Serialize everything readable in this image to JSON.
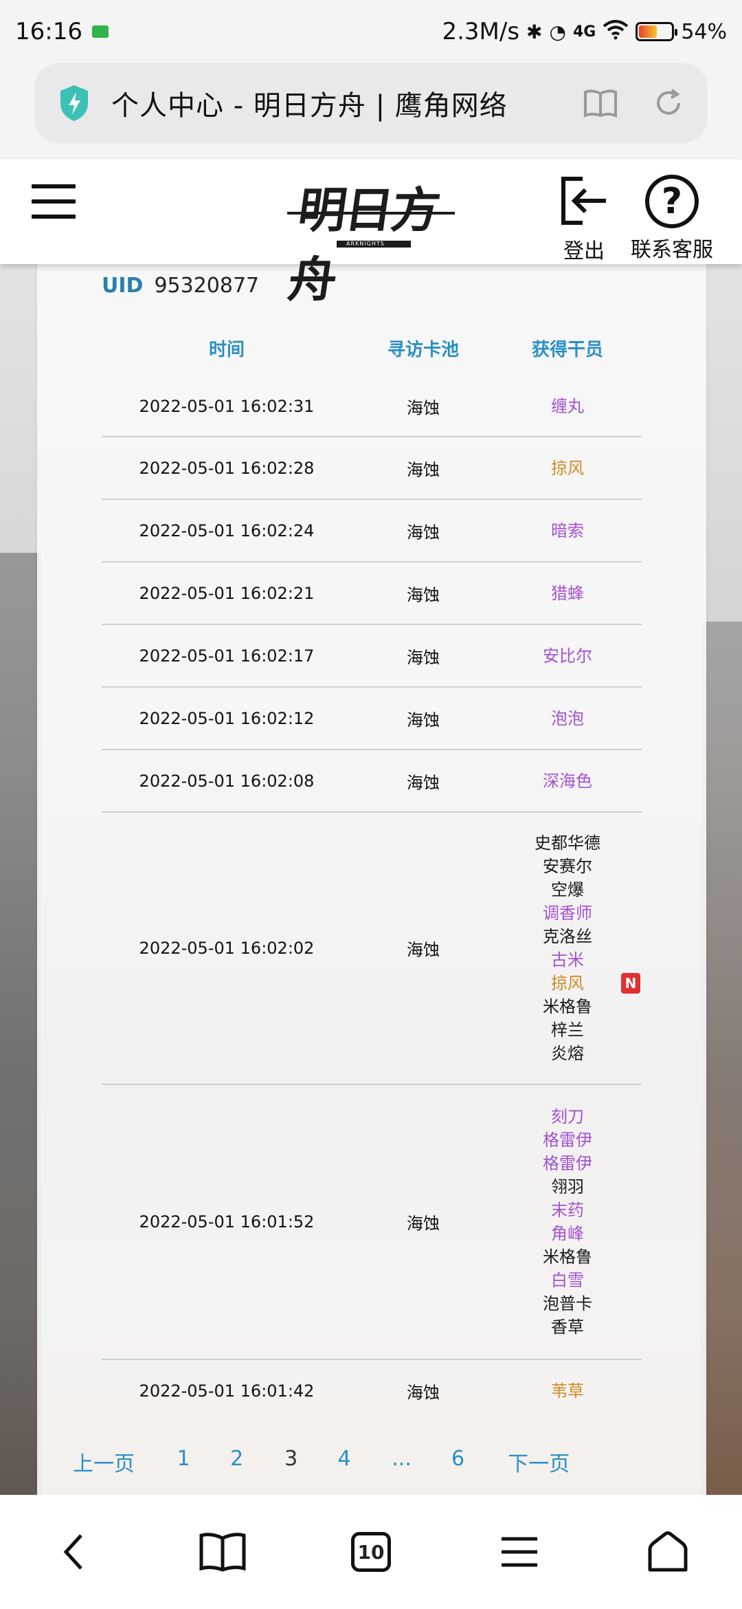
{
  "status_bar": {
    "time": "16:16",
    "speed": "2.3M/s",
    "network": "4G",
    "battery": "54%"
  },
  "address_bar": {
    "title": "个人中心 - 明日方舟 | 鹰角网络"
  },
  "header": {
    "logo_text": "明日方舟",
    "logo_sub": "ARKNIGHTS",
    "logout_label": "登出",
    "support_label": "联系客服"
  },
  "card": {
    "uid_label": "UID",
    "uid_value": "95320877",
    "columns": [
      "时间",
      "寻访卡池",
      "获得干员"
    ],
    "rows": [
      {
        "time": "2022-05-01 16:02:31",
        "pool": "海蚀",
        "ops": [
          {
            "name": "缠丸",
            "rarity": "purple"
          }
        ]
      },
      {
        "time": "2022-05-01 16:02:28",
        "pool": "海蚀",
        "ops": [
          {
            "name": "掠风",
            "rarity": "gold"
          }
        ]
      },
      {
        "time": "2022-05-01 16:02:24",
        "pool": "海蚀",
        "ops": [
          {
            "name": "暗索",
            "rarity": "purple"
          }
        ]
      },
      {
        "time": "2022-05-01 16:02:21",
        "pool": "海蚀",
        "ops": [
          {
            "name": "猎蜂",
            "rarity": "purple"
          }
        ]
      },
      {
        "time": "2022-05-01 16:02:17",
        "pool": "海蚀",
        "ops": [
          {
            "name": "安比尔",
            "rarity": "purple"
          }
        ]
      },
      {
        "time": "2022-05-01 16:02:12",
        "pool": "海蚀",
        "ops": [
          {
            "name": "泡泡",
            "rarity": "purple"
          }
        ]
      },
      {
        "time": "2022-05-01 16:02:08",
        "pool": "海蚀",
        "ops": [
          {
            "name": "深海色",
            "rarity": "purple"
          }
        ]
      },
      {
        "time": "2022-05-01 16:02:02",
        "pool": "海蚀",
        "ops": [
          {
            "name": "史都华德",
            "rarity": "plain"
          },
          {
            "name": "安赛尔",
            "rarity": "plain"
          },
          {
            "name": "空爆",
            "rarity": "plain"
          },
          {
            "name": "调香师",
            "rarity": "purple"
          },
          {
            "name": "克洛丝",
            "rarity": "plain"
          },
          {
            "name": "古米",
            "rarity": "purple"
          },
          {
            "name": "掠风",
            "rarity": "gold",
            "badge": "N"
          },
          {
            "name": "米格鲁",
            "rarity": "plain"
          },
          {
            "name": "梓兰",
            "rarity": "plain"
          },
          {
            "name": "炎熔",
            "rarity": "plain"
          }
        ]
      },
      {
        "time": "2022-05-01 16:01:52",
        "pool": "海蚀",
        "ops": [
          {
            "name": "刻刀",
            "rarity": "purple"
          },
          {
            "name": "格雷伊",
            "rarity": "purple"
          },
          {
            "name": "格雷伊",
            "rarity": "purple"
          },
          {
            "name": "翎羽",
            "rarity": "plain"
          },
          {
            "name": "末药",
            "rarity": "purple"
          },
          {
            "name": "角峰",
            "rarity": "purple"
          },
          {
            "name": "米格鲁",
            "rarity": "plain"
          },
          {
            "name": "白雪",
            "rarity": "purple"
          },
          {
            "name": "泡普卡",
            "rarity": "plain"
          },
          {
            "name": "香草",
            "rarity": "plain"
          }
        ]
      },
      {
        "time": "2022-05-01 16:01:42",
        "pool": "海蚀",
        "ops": [
          {
            "name": "苇草",
            "rarity": "gold"
          }
        ]
      }
    ],
    "pager": {
      "prev": "上一页",
      "pages": [
        "1",
        "2",
        "3",
        "4",
        "...",
        "6"
      ],
      "current": "3",
      "next": "下一页"
    }
  },
  "bottom_nav": {
    "tab_count": "10",
    "icons": [
      "back-icon",
      "bookmarks-icon",
      "tabs-icon",
      "menu-icon",
      "home-icon"
    ]
  },
  "colors": {
    "accent": "#2a8fc4",
    "rarity_purple": "#a352d1",
    "rarity_gold": "#d18a22",
    "new_badge": "#e03030"
  }
}
